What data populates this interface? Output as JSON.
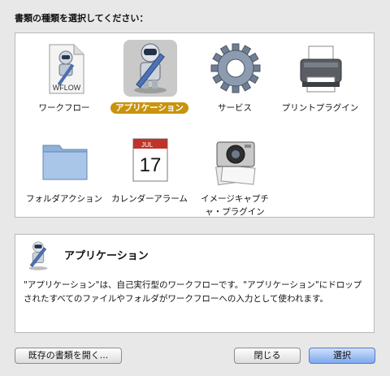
{
  "dialog": {
    "prompt": "書類の種類を選択してください：",
    "doc_types": [
      {
        "label": "ワークフロー",
        "icon": "workflow-file-icon",
        "selected": false
      },
      {
        "label": "アプリケーション",
        "icon": "automator-robot-icon",
        "selected": true
      },
      {
        "label": "サービス",
        "icon": "gear-icon",
        "selected": false
      },
      {
        "label": "プリントプラグイン",
        "icon": "printer-icon",
        "selected": false
      },
      {
        "label": "フォルダアクション",
        "icon": "folder-icon",
        "selected": false
      },
      {
        "label": "カレンダーアラーム",
        "icon": "calendar-icon",
        "selected": false
      },
      {
        "label": "イメージキャプチャ・プラグイン",
        "icon": "camera-icon",
        "selected": false
      }
    ],
    "workflow_icon_text": "WFLOW",
    "calendar_month": "JUL",
    "calendar_day": "17",
    "description": {
      "title": "アプリケーション",
      "text": "\"アプリケーション\"は、自己実行型のワークフローです。\"アプリケーション\"にドロップされたすべてのファイルやフォルダがワークフローへの入力として使われます。"
    },
    "buttons": {
      "open_existing": "既存の書類を開く...",
      "close": "閉じる",
      "choose": "選択"
    },
    "colors": {
      "selection_accent": "#c8930e",
      "default_button": "#7ea8ee"
    }
  }
}
